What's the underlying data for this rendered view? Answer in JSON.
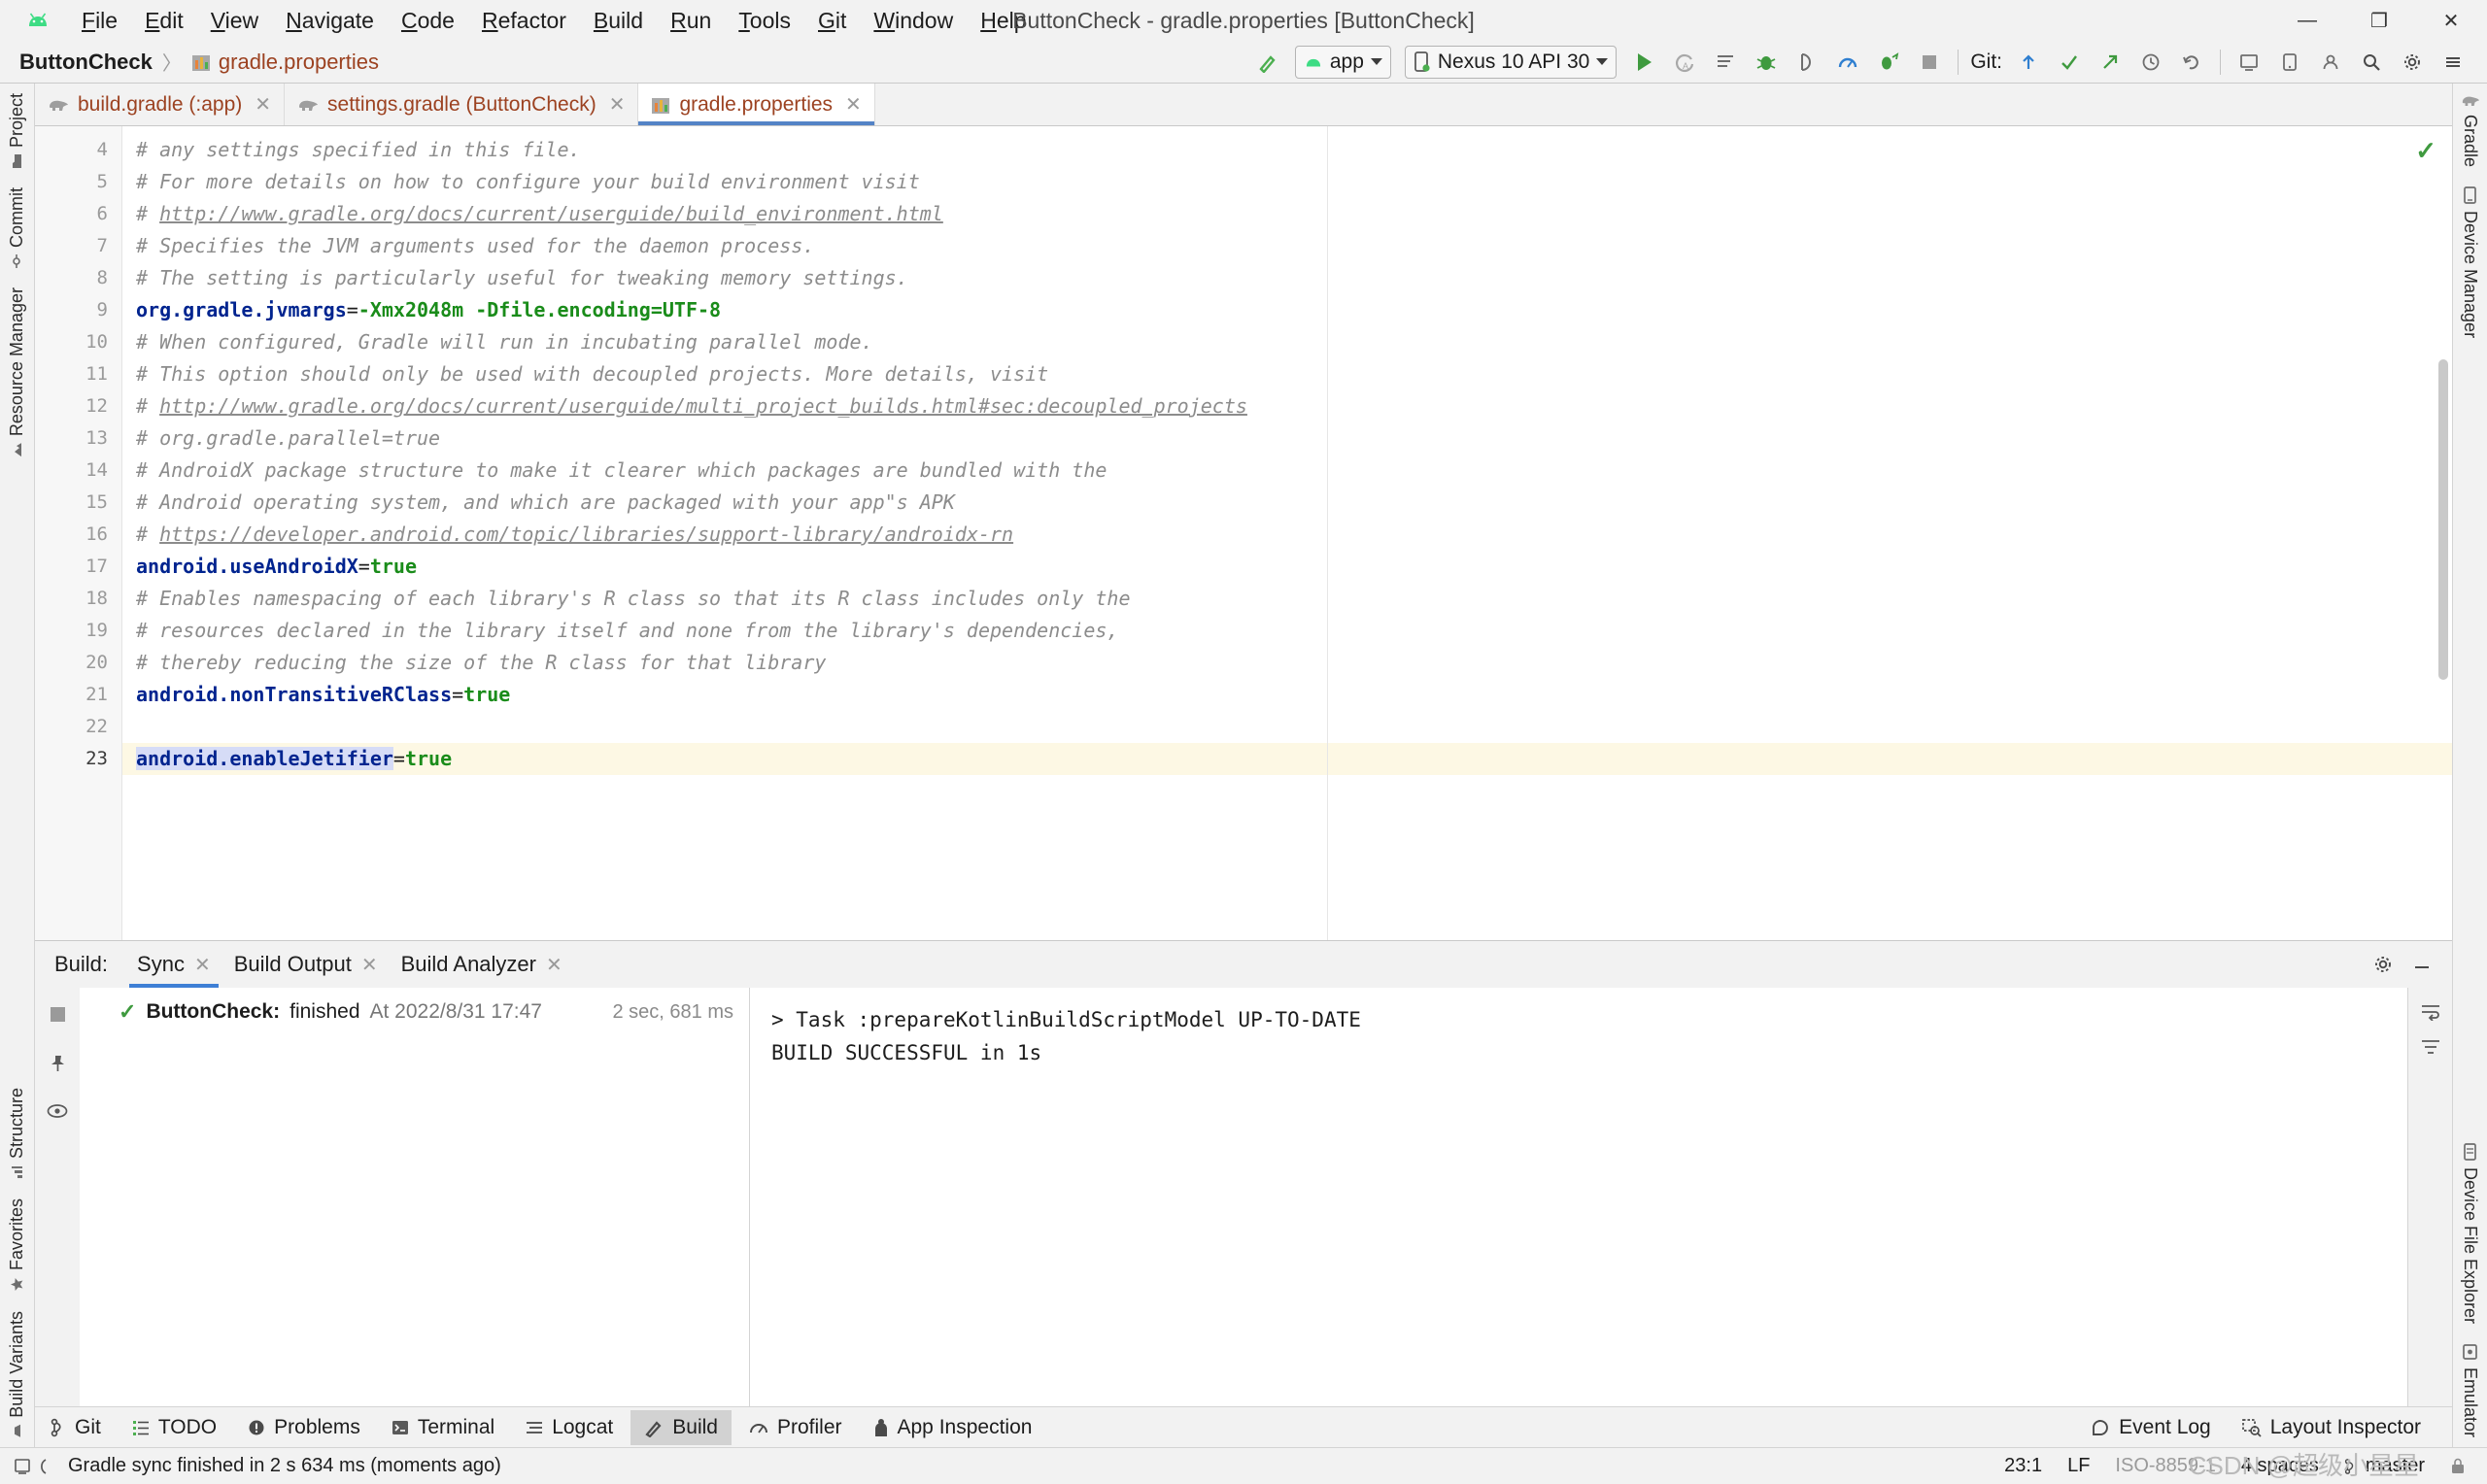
{
  "window": {
    "title": "ButtonCheck - gradle.properties [ButtonCheck]",
    "minimize": "—",
    "maximize": "❐",
    "close": "✕"
  },
  "menubar": {
    "logo_icon": "android-logo-icon",
    "items": [
      {
        "label": "File",
        "mnemonic": "F"
      },
      {
        "label": "Edit",
        "mnemonic": "E"
      },
      {
        "label": "View",
        "mnemonic": "V"
      },
      {
        "label": "Navigate",
        "mnemonic": "N"
      },
      {
        "label": "Code",
        "mnemonic": "C"
      },
      {
        "label": "Refactor",
        "mnemonic": "R"
      },
      {
        "label": "Build",
        "mnemonic": "B"
      },
      {
        "label": "Run",
        "mnemonic": "R"
      },
      {
        "label": "Tools",
        "mnemonic": "T"
      },
      {
        "label": "Git",
        "mnemonic": "G"
      },
      {
        "label": "Window",
        "mnemonic": "W"
      },
      {
        "label": "Help",
        "mnemonic": "H"
      }
    ]
  },
  "breadcrumb": {
    "project": "ButtonCheck",
    "separator": "〉",
    "file": "gradle.properties",
    "file_icon": "gradle-properties-icon"
  },
  "toolbar": {
    "build_icon": "hammer-icon",
    "module_selector": {
      "label": "app",
      "icon": "android-icon",
      "caret": "▾"
    },
    "device_selector": {
      "label": "Nexus 10 API 30",
      "icon": "device-icon",
      "caret": "▾"
    },
    "actions": [
      {
        "name": "run-button",
        "icon": "play-icon"
      },
      {
        "name": "apply-changes-button",
        "icon": "apply-changes-icon"
      },
      {
        "name": "apply-code-changes-button",
        "icon": "apply-code-changes-icon"
      },
      {
        "name": "debug-button",
        "icon": "bug-icon"
      },
      {
        "name": "attach-debugger-button",
        "icon": "attach-debugger-icon"
      },
      {
        "name": "profiler-button",
        "icon": "profiler-icon"
      },
      {
        "name": "run-with-coverage-button",
        "icon": "coverage-icon"
      },
      {
        "name": "stop-button",
        "icon": "stop-icon"
      }
    ],
    "git_label": "Git:",
    "git_actions": [
      {
        "name": "update-project-button",
        "icon": "update-arrow-icon"
      },
      {
        "name": "commit-button",
        "icon": "check-icon"
      },
      {
        "name": "push-button",
        "icon": "push-arrow-icon"
      },
      {
        "name": "history-button",
        "icon": "clock-icon"
      },
      {
        "name": "rollback-button",
        "icon": "undo-icon"
      }
    ],
    "right_actions": [
      {
        "name": "sdk-manager-button",
        "icon": "sdk-manager-icon"
      },
      {
        "name": "avd-manager-button",
        "icon": "avd-manager-icon"
      },
      {
        "name": "profile-button",
        "icon": "profile-icon"
      },
      {
        "name": "search-button",
        "icon": "search-icon"
      },
      {
        "name": "settings-button",
        "icon": "gear-icon"
      },
      {
        "name": "menu-button",
        "icon": "hamburger-icon"
      }
    ]
  },
  "left_toolbar": [
    {
      "label": "Project",
      "icon": "project-folder-icon"
    },
    {
      "label": "Commit",
      "icon": "commit-icon"
    },
    {
      "label": "Resource Manager",
      "icon": "resource-manager-icon"
    },
    {
      "label": "Structure",
      "icon": "structure-icon"
    },
    {
      "label": "Favorites",
      "icon": "star-icon"
    },
    {
      "label": "Build Variants",
      "icon": "build-variants-icon"
    }
  ],
  "right_toolbar": [
    {
      "label": "Gradle",
      "icon": "gradle-elephant-icon"
    },
    {
      "label": "Device Manager",
      "icon": "device-manager-icon"
    },
    {
      "label": "Device File Explorer",
      "icon": "device-file-explorer-icon"
    },
    {
      "label": "Emulator",
      "icon": "emulator-icon"
    }
  ],
  "editor_tabs": [
    {
      "label": "build.gradle (:app)",
      "icon": "gradle-elephant-icon",
      "active": false,
      "close": "✕"
    },
    {
      "label": "settings.gradle (ButtonCheck)",
      "icon": "gradle-elephant-icon",
      "active": false,
      "close": "✕"
    },
    {
      "label": "gradle.properties",
      "icon": "gradle-properties-icon",
      "active": true,
      "close": "✕"
    }
  ],
  "editor": {
    "inspection_ok_icon": "checkmark-icon",
    "first_line_number": 4,
    "current_line": 23,
    "lines": [
      {
        "n": 4,
        "tokens": [
          {
            "t": "comment",
            "v": "# any settings specified in this file."
          }
        ]
      },
      {
        "n": 5,
        "tokens": [
          {
            "t": "comment",
            "v": "# For more details on how to configure your build environment visit"
          }
        ]
      },
      {
        "n": 6,
        "tokens": [
          {
            "t": "comment",
            "v": "# "
          },
          {
            "t": "url",
            "v": "http://www.gradle.org/docs/current/userguide/build_environment.html"
          }
        ]
      },
      {
        "n": 7,
        "tokens": [
          {
            "t": "comment",
            "v": "# Specifies the JVM arguments used for the daemon process."
          }
        ]
      },
      {
        "n": 8,
        "tokens": [
          {
            "t": "comment",
            "v": "# The setting is particularly useful for tweaking memory settings."
          }
        ]
      },
      {
        "n": 9,
        "tokens": [
          {
            "t": "key",
            "v": "org.gradle.jvmargs"
          },
          {
            "t": "eq",
            "v": "="
          },
          {
            "t": "value",
            "v": "-Xmx2048m -Dfile.encoding=UTF-8"
          }
        ]
      },
      {
        "n": 10,
        "tokens": [
          {
            "t": "comment",
            "v": "# When configured, Gradle will run in incubating parallel mode."
          }
        ]
      },
      {
        "n": 11,
        "tokens": [
          {
            "t": "comment",
            "v": "# This option should only be used with decoupled projects. More details, visit"
          }
        ]
      },
      {
        "n": 12,
        "tokens": [
          {
            "t": "comment",
            "v": "# "
          },
          {
            "t": "url",
            "v": "http://www.gradle.org/docs/current/userguide/multi_project_builds.html#sec:decoupled_projects"
          }
        ]
      },
      {
        "n": 13,
        "tokens": [
          {
            "t": "comment",
            "v": "# org.gradle.parallel=true"
          }
        ]
      },
      {
        "n": 14,
        "tokens": [
          {
            "t": "comment",
            "v": "# AndroidX package structure to make it clearer which packages are bundled with the"
          }
        ]
      },
      {
        "n": 15,
        "tokens": [
          {
            "t": "comment",
            "v": "# Android operating system, and which are packaged with your app\"s APK"
          }
        ]
      },
      {
        "n": 16,
        "tokens": [
          {
            "t": "comment",
            "v": "# "
          },
          {
            "t": "url",
            "v": "https://developer.android.com/topic/libraries/support-library/androidx-rn"
          }
        ]
      },
      {
        "n": 17,
        "tokens": [
          {
            "t": "key",
            "v": "android.useAndroidX"
          },
          {
            "t": "eq",
            "v": "="
          },
          {
            "t": "value",
            "v": "true"
          }
        ]
      },
      {
        "n": 18,
        "tokens": [
          {
            "t": "comment",
            "v": "# Enables namespacing of each library's R class so that its R class includes only the"
          }
        ]
      },
      {
        "n": 19,
        "tokens": [
          {
            "t": "comment",
            "v": "# resources declared in the library itself and none from the library's dependencies,"
          }
        ]
      },
      {
        "n": 20,
        "tokens": [
          {
            "t": "comment",
            "v": "# thereby reducing the size of the R class for that library"
          }
        ]
      },
      {
        "n": 21,
        "tokens": [
          {
            "t": "key",
            "v": "android.nonTransitiveRClass"
          },
          {
            "t": "eq",
            "v": "="
          },
          {
            "t": "value",
            "v": "true"
          }
        ]
      },
      {
        "n": 22,
        "tokens": []
      },
      {
        "n": 23,
        "highlight": true,
        "tokens": [
          {
            "t": "key-selected",
            "v": "android.enableJetifier"
          },
          {
            "t": "eq",
            "v": "="
          },
          {
            "t": "value",
            "v": "true"
          }
        ]
      }
    ]
  },
  "build_panel": {
    "title": "Build:",
    "tabs": [
      {
        "label": "Sync",
        "active": true,
        "close": "✕"
      },
      {
        "label": "Build Output",
        "active": false,
        "close": "✕"
      },
      {
        "label": "Build Analyzer",
        "active": false,
        "close": "✕"
      }
    ],
    "header_actions": [
      {
        "name": "build-settings-button",
        "icon": "gear-icon"
      },
      {
        "name": "build-minimize-button",
        "icon": "minimize-icon"
      }
    ],
    "left_strip": [
      {
        "name": "stop-build-button",
        "icon": "stop-icon"
      },
      {
        "name": "pin-tab-button",
        "icon": "pin-icon"
      },
      {
        "name": "toggle-view-button",
        "icon": "eye-icon"
      }
    ],
    "right_strip": [
      {
        "name": "soft-wrap-button",
        "icon": "soft-wrap-icon"
      },
      {
        "name": "filter-button",
        "icon": "filter-icon"
      }
    ],
    "tree": {
      "status_icon": "green-check-icon",
      "project": "ButtonCheck:",
      "state": "finished",
      "timestamp": "At 2022/8/31 17:47",
      "duration": "2 sec, 681 ms"
    },
    "console_lines": [
      "> Task :prepareKotlinBuildScriptModel UP-TO-DATE",
      "",
      "BUILD SUCCESSFUL in 1s"
    ]
  },
  "bottom_tools": [
    {
      "label": "Git",
      "icon": "git-branch-icon",
      "active": false
    },
    {
      "label": "TODO",
      "icon": "todo-list-icon",
      "active": false
    },
    {
      "label": "Problems",
      "icon": "problems-icon",
      "active": false
    },
    {
      "label": "Terminal",
      "icon": "terminal-icon",
      "active": false
    },
    {
      "label": "Logcat",
      "icon": "logcat-icon",
      "active": false
    },
    {
      "label": "Build",
      "icon": "hammer-icon",
      "active": true
    },
    {
      "label": "Profiler",
      "icon": "profiler-icon",
      "active": false
    },
    {
      "label": "App Inspection",
      "icon": "app-inspection-icon",
      "active": false
    }
  ],
  "bottom_right_tools": [
    {
      "label": "Event Log",
      "icon": "event-log-icon"
    },
    {
      "label": "Layout Inspector",
      "icon": "layout-inspector-icon"
    }
  ],
  "statusbar": {
    "memory_icon": "memory-indicator-icon",
    "progress_icon": "progress-spinner-icon",
    "message": "Gradle sync finished in 2 s 634 ms (moments ago)",
    "caret_position": "23:1",
    "line_separator": "LF",
    "encoding": "ISO-8859-1",
    "indent": "4 spaces",
    "branch": "master",
    "branch_icon": "git-branch-icon",
    "lock_icon": "read-only-toggle-icon",
    "watermark": "CSDN @超级小星星"
  },
  "colors": {
    "accent_blue": "#3e7fd5",
    "tab_underline": "#5383c6",
    "comment": "#8c8c8c",
    "key": "#00248f",
    "value": "#1a8c1a",
    "file_tab_text": "#9c4221",
    "success_green": "#3f9a3f",
    "highlight_line": "#fdf8e4",
    "panel_bg": "#f2f2f2",
    "editor_bg": "#ffffff"
  }
}
